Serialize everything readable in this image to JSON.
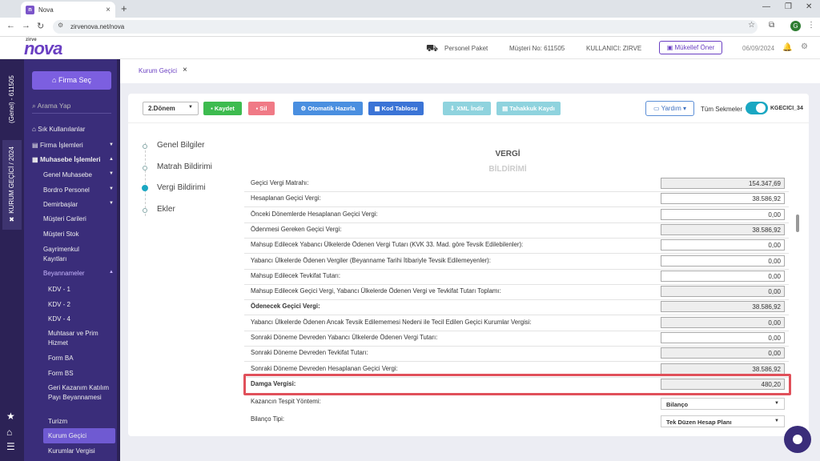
{
  "browser": {
    "tab_title": "Nova",
    "url": "zirvenova.net/nova",
    "profile_initial": "G"
  },
  "header": {
    "logo": "nova",
    "logo_small": "zirve",
    "package": "Personel Paket",
    "musteri_no": "Müşteri No: 611505",
    "kullanici": "KULLANICI: ZIRVE",
    "mukellef_button": "Mükellef Öner",
    "date": "06/09/2024"
  },
  "vstrip": {
    "genel": "(Genel) - 611505",
    "kurum": "✖ KURUM GEÇİCİ / 2024"
  },
  "sidebar": {
    "firma_sec": "Firma Seç",
    "search_placeholder": "Arama Yap",
    "items": [
      "Sık Kullanılanlar",
      "Firma İşlemleri",
      "Muhasebe İşlemleri"
    ],
    "sub": [
      "Genel Muhasebe",
      "Bordro Personel",
      "Demirbaşlar",
      "Müşteri Carileri",
      "Müşteri Stok",
      "Gayrimenkul Kayıtları",
      "Beyannameler"
    ],
    "beyan": [
      "KDV - 1",
      "KDV - 2",
      "KDV - 4",
      "Muhtasar ve Prim Hizmet",
      "Form BA",
      "Form BS",
      "Geri Kazanım Katılım Payı Beyannamesi",
      "Turizm",
      "Kurum Geçici",
      "Kurumlar Vergisi"
    ]
  },
  "breadcrumb": "Kurum Geçici",
  "toolbar": {
    "donem": "2.Dönem",
    "kaydet": "Kaydet",
    "sil": "Sil",
    "otomatik": "Otomatik Hazırla",
    "kod": "Kod Tablosu",
    "xml": "XML İndir",
    "tahakkuk": "Tahakkuk Kaydı",
    "yardim": "Yardım",
    "tum_sekmeler": "Tüm Sekmeler",
    "code": "KGECICI_34"
  },
  "steps": [
    "Genel Bilgiler",
    "Matrah Bildirimi",
    "Vergi Bildirimi",
    "Ekler"
  ],
  "section": {
    "title1": "VERGİ",
    "title2": "BİLDİRİMİ"
  },
  "rows": [
    {
      "label": "Geçici Vergi Matrahı:",
      "value": "154.347,69",
      "ro": true
    },
    {
      "label": "Hesaplanan Geçici Vergi:",
      "value": "38.586,92",
      "ro": false
    },
    {
      "label": "Önceki Dönemlerde Hesaplanan Geçici Vergi:",
      "value": "0,00",
      "ro": false
    },
    {
      "label": "Ödenmesi Gereken Geçici Vergi:",
      "value": "38.586,92",
      "ro": true
    },
    {
      "label": "Mahsup Edilecek Yabancı Ülkelerde Ödenen Vergi Tutarı (KVK 33. Mad. göre Tevsik Edilebilenler):",
      "value": "0,00",
      "ro": false
    },
    {
      "label": "Yabancı Ülkelerde Ödenen Vergiler (Beyanname Tarihi İtibariyle Tevsik Edilemeyenler):",
      "value": "0,00",
      "ro": false
    },
    {
      "label": "Mahsup Edilecek Tevkifat Tutarı:",
      "value": "0,00",
      "ro": false
    },
    {
      "label": "Mahsup Edilecek Geçici Vergi, Yabancı Ülkelerde Ödenen Vergi ve Tevkifat Tutarı Toplamı:",
      "value": "0,00",
      "ro": true
    },
    {
      "label": "Ödenecek Geçici Vergi:",
      "value": "38.586,92",
      "ro": true
    },
    {
      "label": "Yabancı Ülkelerde Ödenen Ancak Tevsik Edilememesi Nedeni ile Tecil Edilen Geçici Kurumlar Vergisi:",
      "value": "0,00",
      "ro": true
    },
    {
      "label": "Sonraki Döneme Devreden Yabancı Ülkelerde Ödenen Vergi Tutarı:",
      "value": "0,00",
      "ro": false
    },
    {
      "label": "Sonraki Döneme Devreden Tevkifat Tutarı:",
      "value": "0,00",
      "ro": true
    },
    {
      "label": "Sonraki Döneme Devreden Hesaplanan Geçici Vergi:",
      "value": "38.586,92",
      "ro": true
    },
    {
      "label": "Damga Vergisi:",
      "value": "480,20",
      "ro": true
    }
  ],
  "dropdowns": [
    {
      "label": "Kazancın Tespit Yöntemi:",
      "value": "Bilanço"
    },
    {
      "label": "Bilanço Tipi:",
      "value": "Tek Düzen Hesap Planı"
    }
  ]
}
